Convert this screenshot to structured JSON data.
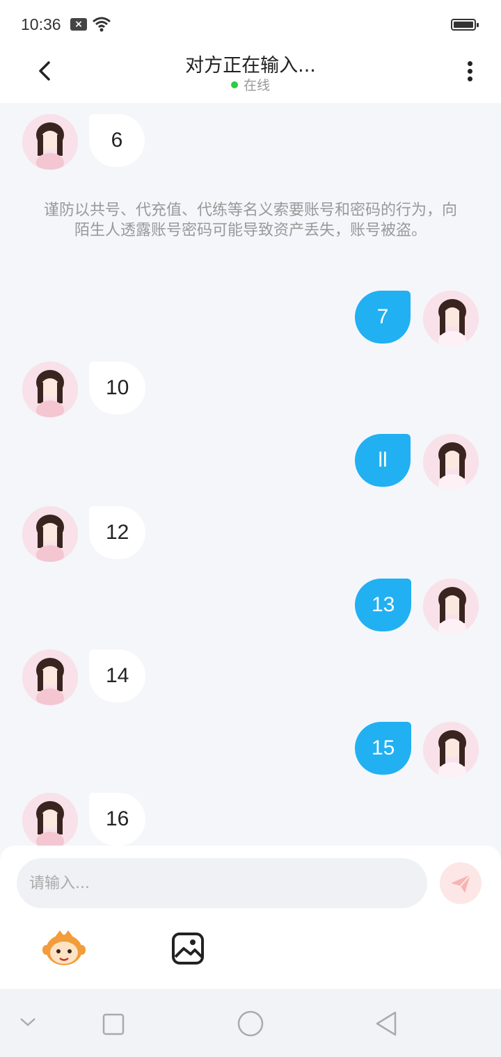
{
  "status": {
    "time": "10:36",
    "x_badge": "×"
  },
  "header": {
    "title": "对方正在输入...",
    "status_text": "在线"
  },
  "messages": [
    {
      "side": "in",
      "text": "6"
    },
    {
      "side": "notice",
      "text": "谨防以共号、代充值、代练等名义索要账号和密码的行为，向陌生人透露账号密码可能导致资产丢失，账号被盗。"
    },
    {
      "side": "out",
      "text": "7"
    },
    {
      "side": "in",
      "text": "10"
    },
    {
      "side": "out",
      "text": "ll"
    },
    {
      "side": "in",
      "text": "12"
    },
    {
      "side": "out",
      "text": "13"
    },
    {
      "side": "in",
      "text": "14"
    },
    {
      "side": "out",
      "text": "15"
    },
    {
      "side": "in",
      "text": "16"
    }
  ],
  "input": {
    "placeholder": "请输入..."
  },
  "colors": {
    "accent": "#21b0f2",
    "send_disabled": "#fde6e6",
    "online": "#2ecc40"
  },
  "icons": [
    "back-icon",
    "more-icon",
    "send-icon",
    "emoji-icon",
    "image-icon",
    "nav-down-icon",
    "nav-square-icon",
    "nav-circle-icon",
    "nav-triangle-icon"
  ]
}
